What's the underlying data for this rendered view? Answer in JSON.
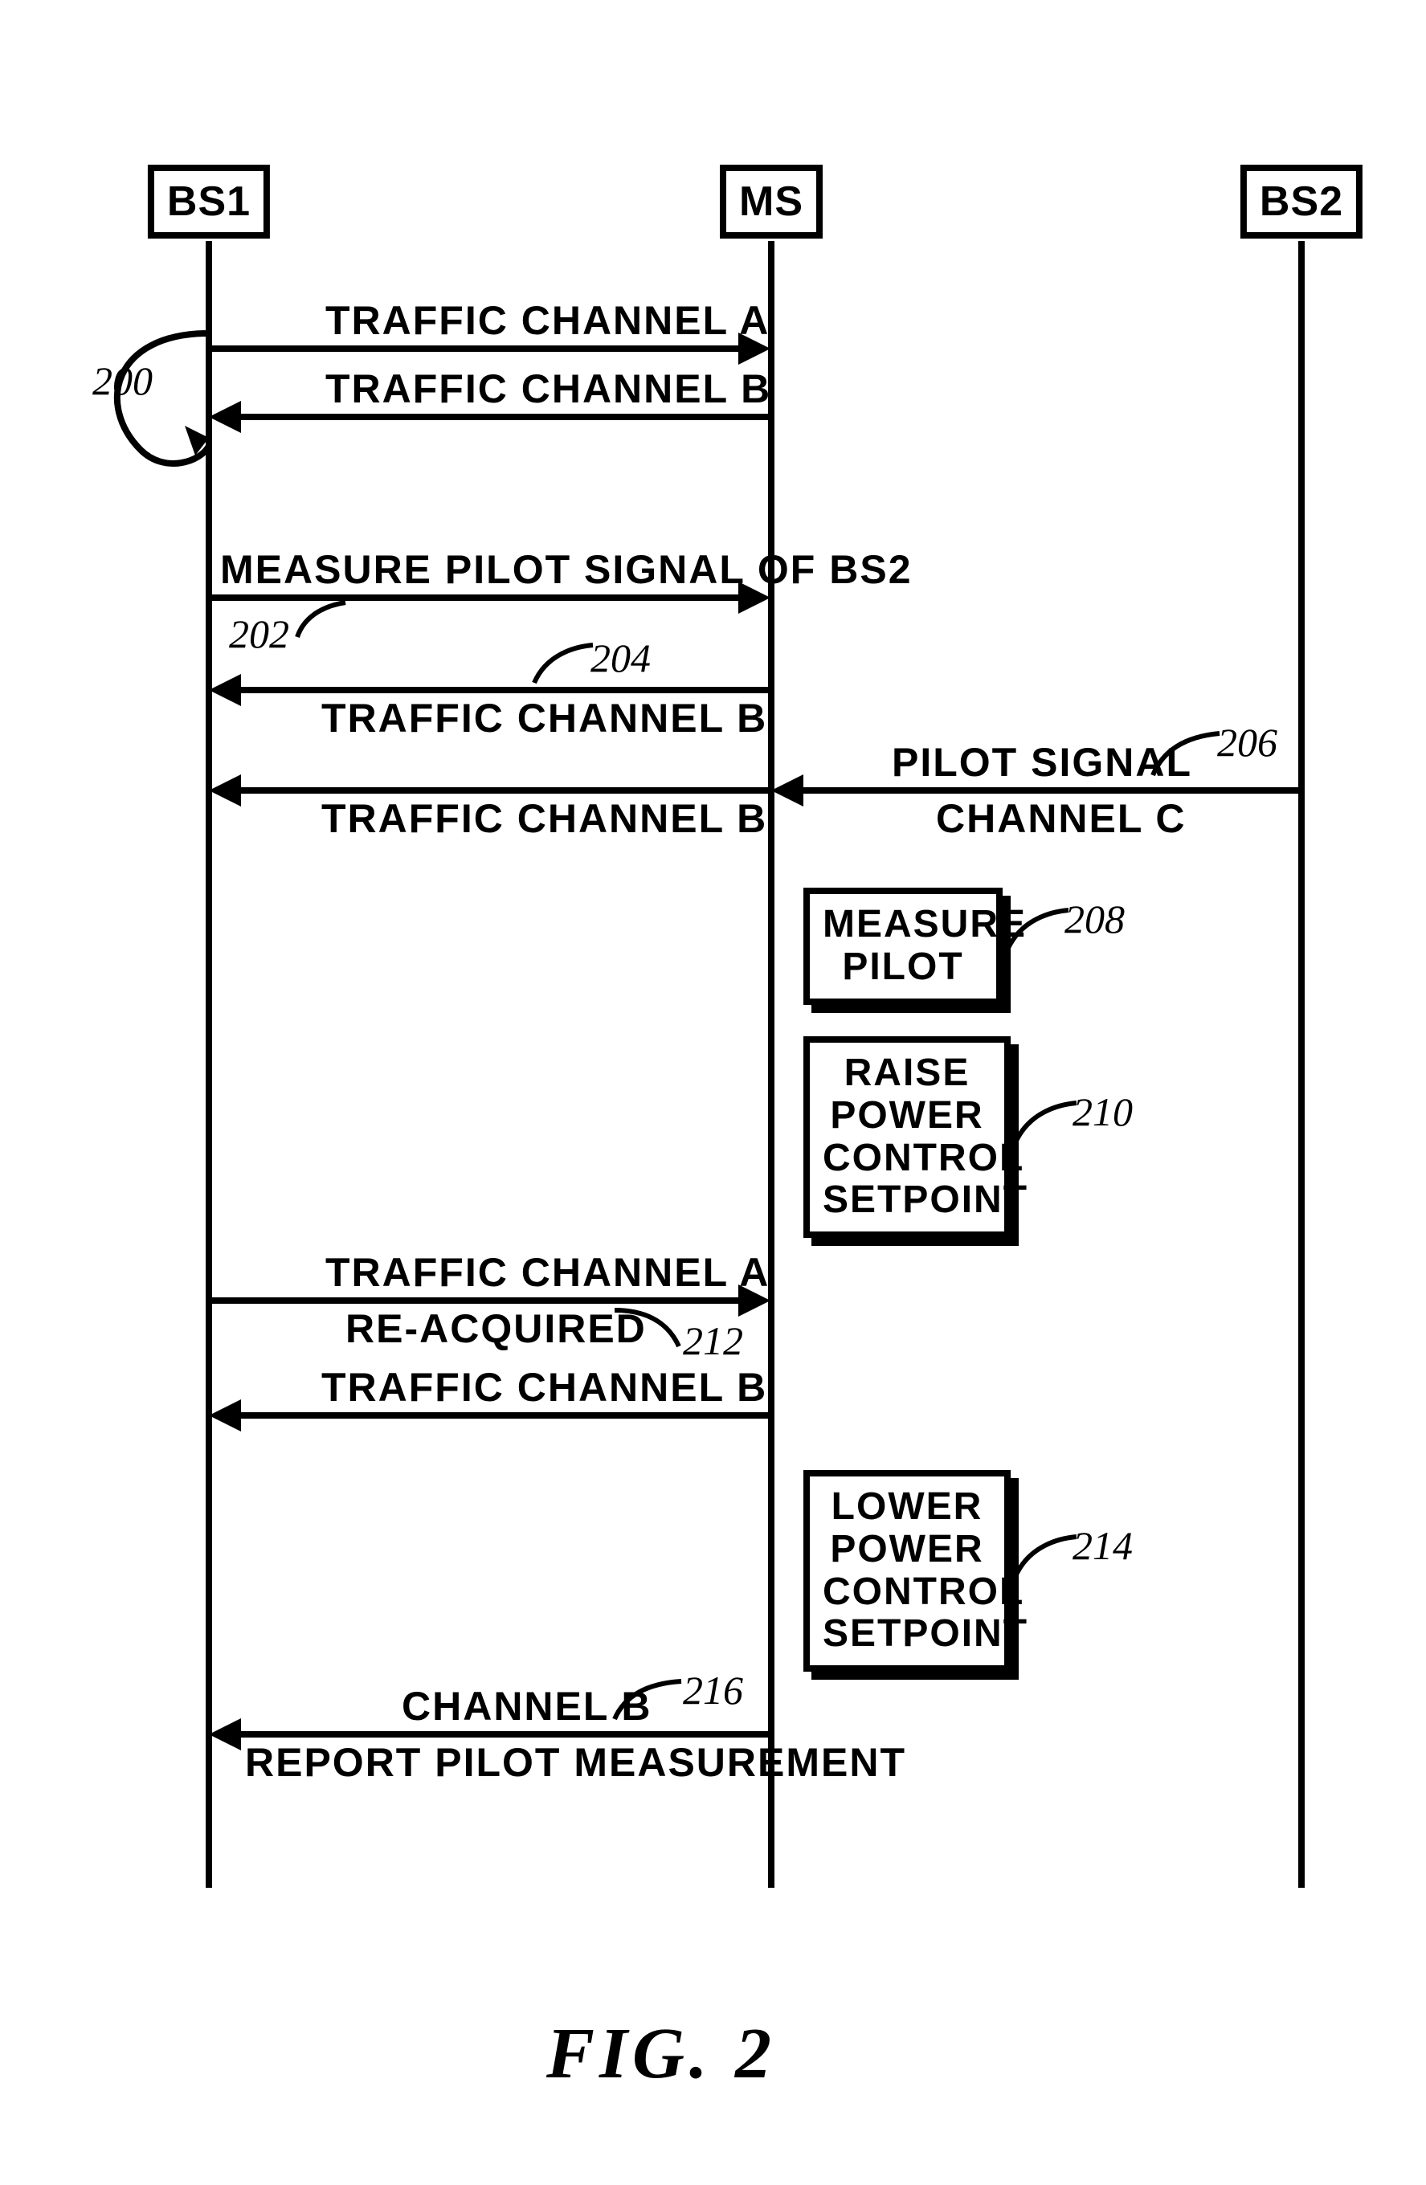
{
  "figure_label": "FIG. 2",
  "participants": {
    "bs1": "BS1",
    "ms": "MS",
    "bs2": "BS2"
  },
  "messages": {
    "trafA_1": "TRAFFIC CHANNEL A",
    "trafB_1": "TRAFFIC CHANNEL B",
    "measure_cmd": "MEASURE PILOT SIGNAL OF BS2",
    "trafB_2": "TRAFFIC CHANNEL B",
    "pilot_sig": "PILOT SIGNAL",
    "trafB_3": "TRAFFIC CHANNEL B",
    "channel_c": "CHANNEL C",
    "trafA_re": "TRAFFIC CHANNEL A",
    "reacq": "RE-ACQUIRED",
    "trafB_4": "TRAFFIC CHANNEL B",
    "chanB": "CHANNEL B",
    "report": "REPORT PILOT MEASUREMENT"
  },
  "nodes": {
    "measure_pilot": "MEASURE\nPILOT",
    "raise": "RAISE\nPOWER\nCONTROL\nSETPOINT",
    "lower": "LOWER\nPOWER\nCONTROL\nSETPOINT"
  },
  "refs": {
    "r200": "200",
    "r202": "202",
    "r204": "204",
    "r206": "206",
    "r208": "208",
    "r210": "210",
    "r212": "212",
    "r214": "214",
    "r216": "216"
  }
}
